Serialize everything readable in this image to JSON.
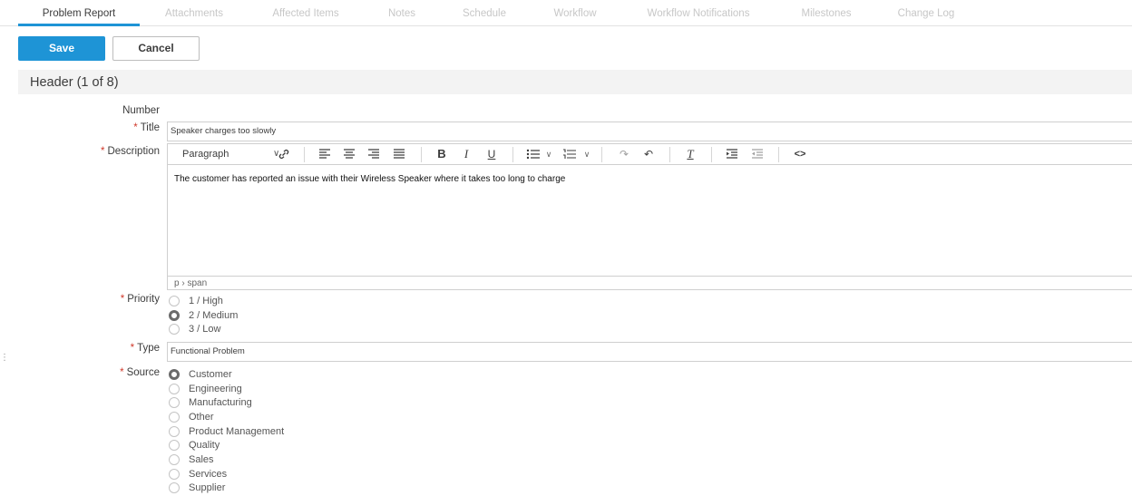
{
  "tabs": [
    {
      "label": "Problem Report",
      "active": true
    },
    {
      "label": "Attachments"
    },
    {
      "label": "Affected Items"
    },
    {
      "label": "Notes"
    },
    {
      "label": "Schedule"
    },
    {
      "label": "Workflow"
    },
    {
      "label": "Workflow Notifications"
    },
    {
      "label": "Milestones"
    },
    {
      "label": "Change Log"
    }
  ],
  "actions": {
    "save_label": "Save",
    "cancel_label": "Cancel"
  },
  "section": {
    "title": "Header (1 of 8)"
  },
  "fields": {
    "number": {
      "label": "Number",
      "value": ""
    },
    "title": {
      "label": "Title",
      "required": "*",
      "value": "Speaker charges too slowly"
    },
    "description": {
      "label": "Description",
      "required": "*",
      "paragraph_format": "Paragraph",
      "content": "The customer has reported an issue with their Wireless Speaker where it takes too long to charge",
      "status_path": "p › span"
    },
    "priority": {
      "label": "Priority",
      "required": "*",
      "options": [
        "1 / High",
        "2 / Medium",
        "3 / Low"
      ],
      "selected": "2 / Medium"
    },
    "type": {
      "label": "Type",
      "required": "*",
      "value": "Functional Problem"
    },
    "source": {
      "label": "Source",
      "required": "*",
      "options": [
        "Customer",
        "Engineering",
        "Manufacturing",
        "Other",
        "Product Management",
        "Quality",
        "Sales",
        "Services",
        "Supplier"
      ],
      "selected": "Customer"
    }
  },
  "toolbar_icons": [
    "link-icon",
    "align-left-icon",
    "align-center-icon",
    "align-right-icon",
    "align-justify-icon",
    "bold-icon",
    "italic-icon",
    "underline-icon",
    "bullet-list-icon",
    "numbered-list-icon",
    "redo-icon",
    "undo-icon",
    "clear-format-icon",
    "indent-icon",
    "outdent-icon",
    "source-code-icon"
  ],
  "colors": {
    "accent": "#1e94d6",
    "required": "#d0392b",
    "section_bg": "#f3f3f3"
  }
}
